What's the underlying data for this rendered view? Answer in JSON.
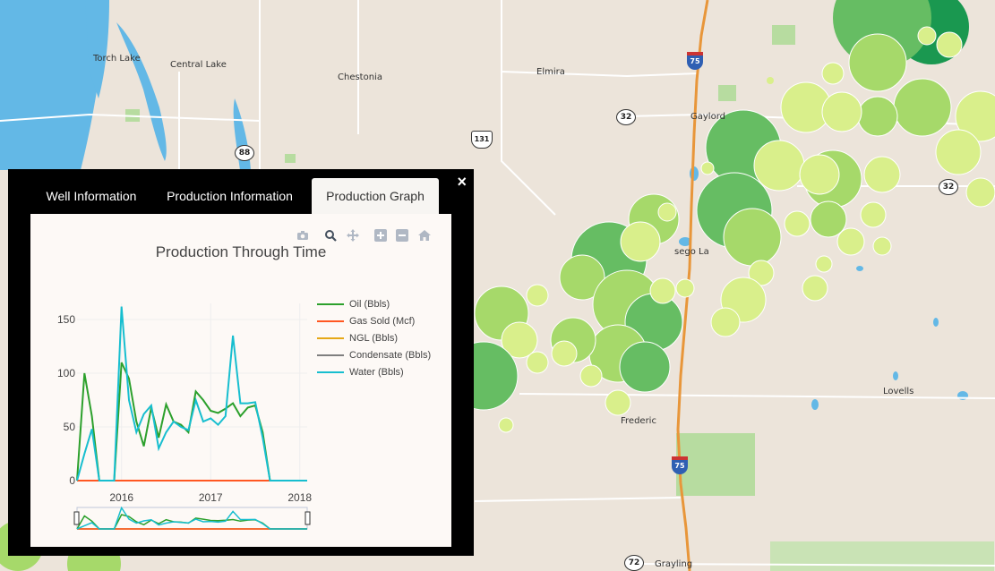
{
  "map": {
    "places": [
      "Torch Lake",
      "Central Lake",
      "Chestonia",
      "Elmira",
      "Gaylord",
      "Lovells",
      "Frederic",
      "Grayling",
      "sego La"
    ],
    "routes": {
      "m32_a": "32",
      "m32_b": "32",
      "m88": "88",
      "m72": "72",
      "us131": "131",
      "i75_a": "75",
      "i75_b": "75"
    }
  },
  "popup": {
    "tabs": [
      "Well Information",
      "Production Information",
      "Production Graph"
    ],
    "active_tab": "Production Graph",
    "close_label": "×"
  },
  "modebar": [
    "camera-icon",
    "zoom-icon",
    "pan-icon",
    "zoom-in-icon",
    "zoom-out-icon",
    "reset-home-icon"
  ],
  "colors": {
    "oil": "#2ca02c",
    "gas": "#ff5722",
    "ngl": "#e6a817",
    "condensate": "#7f7f7f",
    "water": "#17becf"
  },
  "chart_data": {
    "type": "line",
    "title": "Production Through Time",
    "xlabel": "",
    "ylabel": "",
    "x_ticks": [
      "2016",
      "2017",
      "2018"
    ],
    "y_ticks": [
      "0",
      "50",
      "100",
      "150"
    ],
    "ylim": [
      0,
      165
    ],
    "xlim": [
      "2015-07",
      "2018-02"
    ],
    "grid": true,
    "legend_position": "right",
    "range_slider": true,
    "x": [
      "2015-07",
      "2015-08",
      "2015-09",
      "2015-10",
      "2015-11",
      "2015-12",
      "2016-01",
      "2016-02",
      "2016-03",
      "2016-04",
      "2016-05",
      "2016-06",
      "2016-07",
      "2016-08",
      "2016-09",
      "2016-10",
      "2016-11",
      "2016-12",
      "2017-01",
      "2017-02",
      "2017-03",
      "2017-04",
      "2017-05",
      "2017-06",
      "2017-07",
      "2017-08",
      "2017-09",
      "2017-10",
      "2017-11",
      "2017-12",
      "2018-01",
      "2018-02"
    ],
    "series": [
      {
        "name": "Oil (Bbls)",
        "color": "#2ca02c",
        "values": [
          0,
          100,
          60,
          0,
          0,
          0,
          110,
          95,
          55,
          32,
          68,
          40,
          71,
          55,
          52,
          45,
          83,
          75,
          65,
          63,
          67,
          72,
          60,
          68,
          70,
          45,
          0,
          0,
          0,
          0,
          0,
          0
        ]
      },
      {
        "name": "Gas Sold (Mcf)",
        "color": "#ff5722",
        "values": [
          0,
          0,
          0,
          0,
          0,
          0,
          0,
          0,
          0,
          0,
          0,
          0,
          0,
          0,
          0,
          0,
          0,
          0,
          0,
          0,
          0,
          0,
          0,
          0,
          0,
          0,
          0,
          0,
          0,
          0,
          0,
          0
        ]
      },
      {
        "name": "NGL (Bbls)",
        "color": "#e6a817",
        "values": [
          0,
          0,
          0,
          0,
          0,
          0,
          0,
          0,
          0,
          0,
          0,
          0,
          0,
          0,
          0,
          0,
          0,
          0,
          0,
          0,
          0,
          0,
          0,
          0,
          0,
          0,
          0,
          0,
          0,
          0,
          0,
          0
        ]
      },
      {
        "name": "Condensate (Bbls)",
        "color": "#7f7f7f",
        "values": [
          0,
          0,
          0,
          0,
          0,
          0,
          0,
          0,
          0,
          0,
          0,
          0,
          0,
          0,
          0,
          0,
          0,
          0,
          0,
          0,
          0,
          0,
          0,
          0,
          0,
          0,
          0,
          0,
          0,
          0,
          0,
          0
        ]
      },
      {
        "name": "Water (Bbls)",
        "color": "#17becf",
        "values": [
          0,
          25,
          48,
          0,
          0,
          0,
          162,
          75,
          45,
          62,
          70,
          30,
          45,
          55,
          50,
          47,
          75,
          55,
          58,
          52,
          60,
          135,
          72,
          72,
          73,
          40,
          0,
          0,
          0,
          0,
          0,
          0
        ]
      }
    ]
  }
}
